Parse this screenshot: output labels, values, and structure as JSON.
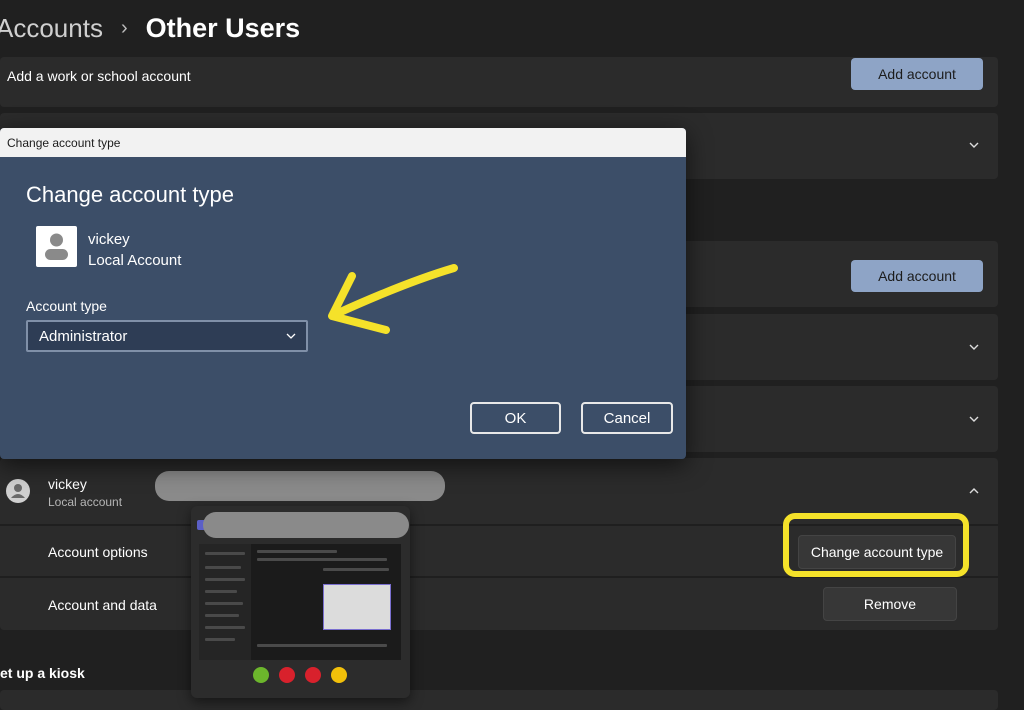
{
  "breadcrumb": {
    "parent": "Accounts",
    "separator": "›",
    "current": "Other Users"
  },
  "work_school": {
    "label": "Add a work or school account",
    "button": "Add account"
  },
  "family": {
    "button": "Add account"
  },
  "user_card": {
    "name": "vickey",
    "type": "Local account",
    "options_label": "Account options",
    "options_button": "Change account type",
    "data_label": "Account and data",
    "data_button": "Remove"
  },
  "kiosk": {
    "label": "et up a kiosk"
  },
  "dialog": {
    "window_title": "Change account type",
    "heading": "Change account type",
    "user_name": "vickey",
    "user_type": "Local Account",
    "account_type_label": "Account type",
    "account_type_value": "Administrator",
    "ok": "OK",
    "cancel": "Cancel"
  },
  "icons": {
    "chevron": "chevron-down-icon",
    "avatar": "user-avatar-icon",
    "teams": "teams-icon"
  },
  "colors": {
    "accent_button": "#8ea4c6",
    "dialog_bg": "#3c4e68",
    "highlight": "#f5e22a",
    "call_green": "#6cb62c",
    "call_red": "#d8212c",
    "call_yellow": "#f2c00a"
  }
}
